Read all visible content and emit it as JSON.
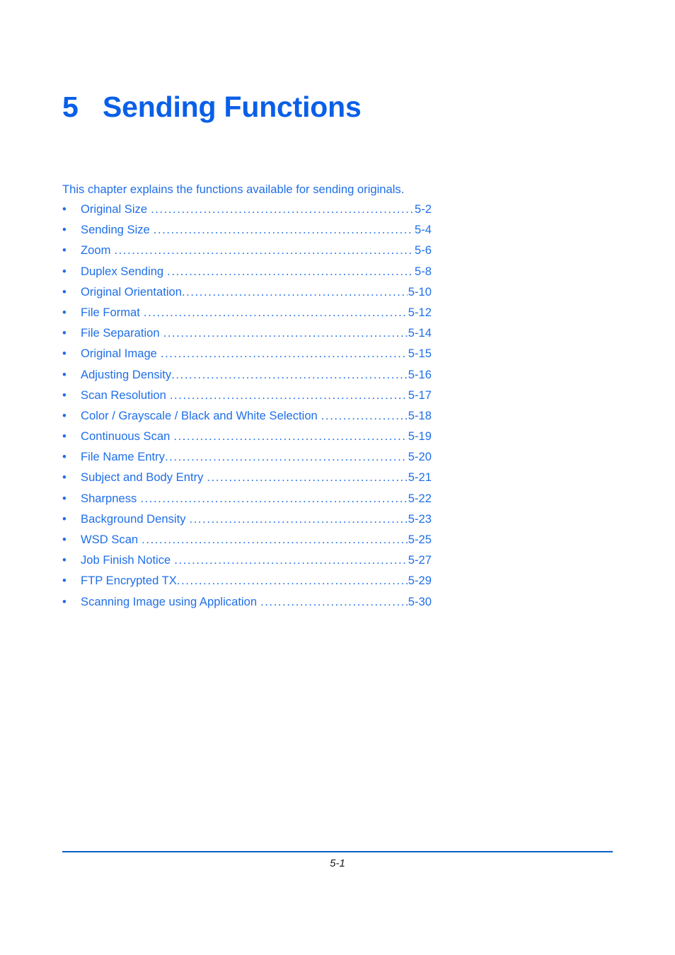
{
  "document": {
    "heading": {
      "number": "5",
      "title": "Sending Functions"
    },
    "intro": "This chapter explains the functions available for sending originals.",
    "bullet_glyph": "•",
    "toc": [
      {
        "label": "Original Size",
        "space_before_leader": true,
        "page": "5-2"
      },
      {
        "label": "Sending Size",
        "space_before_leader": true,
        "page": "5-4"
      },
      {
        "label": "Zoom",
        "space_before_leader": true,
        "page": "5-6"
      },
      {
        "label": "Duplex Sending",
        "space_before_leader": true,
        "page": "5-8"
      },
      {
        "label": "Original Orientation",
        "space_before_leader": false,
        "page": "5-10"
      },
      {
        "label": "File Format",
        "space_before_leader": true,
        "page": "5-12"
      },
      {
        "label": "File Separation",
        "space_before_leader": true,
        "page": "5-14"
      },
      {
        "label": "Original Image",
        "space_before_leader": true,
        "page": "5-15"
      },
      {
        "label": "Adjusting Density",
        "space_before_leader": false,
        "page": "5-16"
      },
      {
        "label": "Scan Resolution",
        "space_before_leader": true,
        "page": "5-17"
      },
      {
        "label": "Color / Grayscale / Black and White Selection",
        "space_before_leader": true,
        "page": "5-18"
      },
      {
        "label": "Continuous Scan",
        "space_before_leader": true,
        "page": "5-19"
      },
      {
        "label": "File Name Entry",
        "space_before_leader": false,
        "page": "5-20"
      },
      {
        "label": "Subject and Body Entry",
        "space_before_leader": true,
        "page": "5-21"
      },
      {
        "label": "Sharpness",
        "space_before_leader": true,
        "page": "5-22"
      },
      {
        "label": "Background Density",
        "space_before_leader": true,
        "page": "5-23"
      },
      {
        "label": "WSD Scan",
        "space_before_leader": true,
        "page": "5-25"
      },
      {
        "label": "Job Finish Notice",
        "space_before_leader": true,
        "page": "5-27"
      },
      {
        "label": "FTP Encrypted TX",
        "space_before_leader": false,
        "page": "5-29"
      },
      {
        "label": "Scanning Image using Application",
        "space_before_leader": true,
        "page": "5-30"
      }
    ],
    "footer": {
      "page_number": "5-1"
    },
    "colors": {
      "heading_blue": "#0a5fe8",
      "body_blue": "#1f6fe8",
      "rule_blue": "#0a5fc8",
      "page_number_color": "#1a1a1a",
      "background": "#ffffff"
    }
  }
}
